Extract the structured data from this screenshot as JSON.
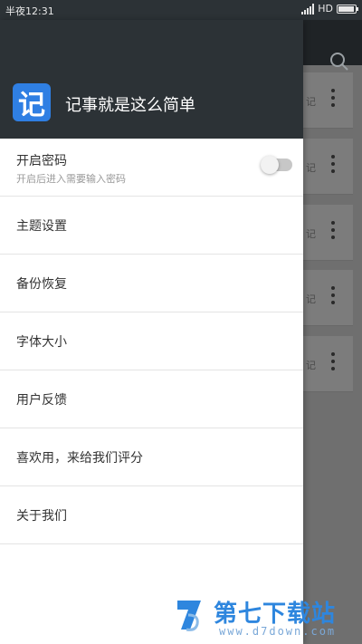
{
  "status_bar": {
    "time": "半夜12:31",
    "network": "HD"
  },
  "background": {
    "card_char": "记",
    "card_count": 5
  },
  "drawer": {
    "app_logo_char": "记",
    "app_title": "记事就是这么简单",
    "password": {
      "title": "开启密码",
      "subtitle": "开启后进入需要输入密码",
      "enabled": false
    },
    "items": [
      {
        "label": "主题设置"
      },
      {
        "label": "备份恢复"
      },
      {
        "label": "字体大小"
      },
      {
        "label": "用户反馈"
      },
      {
        "label": "喜欢用，来给我们评分"
      },
      {
        "label": "关于我们"
      }
    ]
  },
  "watermark": {
    "text": "第七下载站",
    "url": "www.d7down.com"
  },
  "colors": {
    "header_bg": "#2c3236",
    "logo_bg": "#2f7fe3",
    "dim_overlay": "#6f6f6f"
  }
}
